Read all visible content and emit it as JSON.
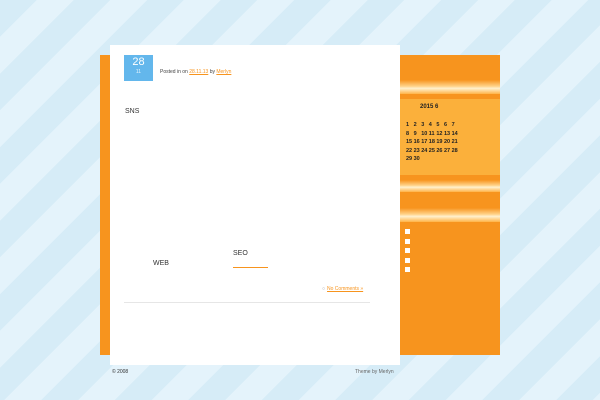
{
  "post": {
    "date_day": "28",
    "date_month": "11",
    "meta_prefix": "Posted in on",
    "meta_date": "28.11.13",
    "meta_by": "by",
    "meta_author": "Merlyn",
    "title": "SNS",
    "web_label": "WEB",
    "seo_label": "SEO",
    "comments_link": "No Comments »"
  },
  "sidebar": {
    "calendar_title": "2015  6",
    "calendar_rows": [
      [
        "1",
        "2",
        "3",
        "4",
        "5",
        "6",
        "7"
      ],
      [
        "8",
        "9",
        "10",
        "11",
        "12",
        "13",
        "14"
      ],
      [
        "15",
        "16",
        "17",
        "18",
        "19",
        "20",
        "21"
      ],
      [
        "22",
        "23",
        "24",
        "25",
        "26",
        "27",
        "28"
      ],
      [
        "29",
        "30"
      ]
    ]
  },
  "footer": {
    "copyright": "© 2008",
    "theme_credit": "Theme by Merlyn"
  },
  "colors": {
    "accent_orange": "#f7941e",
    "calendar_bg": "#fbb03b",
    "date_badge_blue": "#63b7ec"
  }
}
